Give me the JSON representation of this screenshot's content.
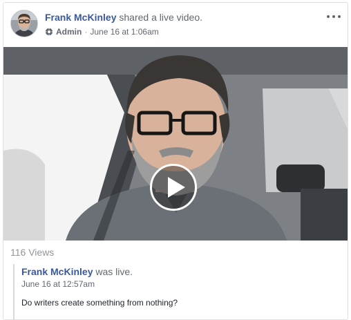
{
  "post": {
    "author": "Frank McKinley",
    "action": "shared a live video.",
    "role": "Admin",
    "separator": "·",
    "timestamp": "June 16 at 1:06am",
    "role_icon": "gear-icon",
    "more_icon": "more-options-icon"
  },
  "video": {
    "play_icon": "play-icon"
  },
  "stats": {
    "views": "116 Views"
  },
  "shared": {
    "author": "Frank McKinley",
    "action": "was live.",
    "timestamp": "June 16 at 12:57am",
    "body": "Do writers create something from nothing?"
  },
  "colors": {
    "link": "#385898",
    "secondary_text": "#616770",
    "muted_text": "#90949c",
    "border": "#dddfe2"
  }
}
